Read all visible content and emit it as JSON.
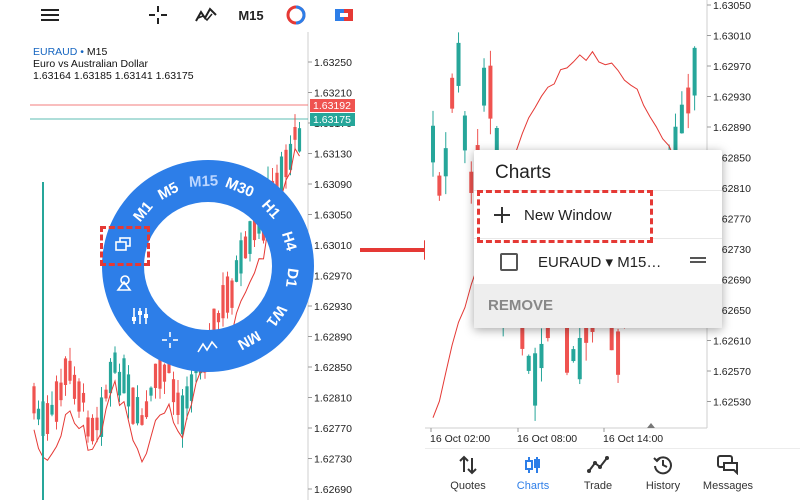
{
  "left": {
    "toolbar": {
      "timeframe": "M15"
    },
    "symbol_name": "EURAUD",
    "timeframe_label": "M15",
    "description": "Euro vs Australian Dollar",
    "ohlc": "1.63164 1.63185 1.63141 1.63175",
    "price_axis": [
      "1.63250",
      "1.63210",
      "1.63170",
      "1.63130",
      "1.63090",
      "1.63050",
      "1.63010",
      "1.62970",
      "1.62930",
      "1.62890",
      "1.62850",
      "1.62810",
      "1.62770",
      "1.62730",
      "1.62690"
    ],
    "bid_tag": "1.63192",
    "last_tag": "1.63175",
    "wheel": {
      "timeframes": [
        "M1",
        "M5",
        "M15",
        "M30",
        "H1",
        "H4",
        "D1",
        "W1",
        "MN"
      ],
      "selected": "M15"
    }
  },
  "right": {
    "price_axis": [
      "1.63050",
      "1.63010",
      "1.62970",
      "1.62930",
      "1.62890",
      "1.62850",
      "1.62810",
      "1.62770",
      "1.62730",
      "1.62690",
      "1.62650",
      "1.62610",
      "1.62570",
      "1.62530"
    ],
    "time_axis": [
      "16 Oct 02:00",
      "16 Oct 08:00",
      "16 Oct 14:00"
    ],
    "menu": {
      "title": "Charts",
      "new_window": "New Window",
      "chart_item": "EURAUD ▾ M15…",
      "remove": "REMOVE"
    },
    "nav": [
      {
        "label": "Quotes",
        "icon": "quotes-icon",
        "active": false
      },
      {
        "label": "Charts",
        "icon": "charts-icon",
        "active": true
      },
      {
        "label": "Trade",
        "icon": "trade-icon",
        "active": false
      },
      {
        "label": "History",
        "icon": "history-icon",
        "active": false
      },
      {
        "label": "Messages",
        "icon": "messages-icon",
        "active": false
      }
    ]
  },
  "colors": {
    "bull": "#26a69a",
    "bear": "#ef5350",
    "accent": "#2d7ee8",
    "highlight": "#e53935"
  }
}
